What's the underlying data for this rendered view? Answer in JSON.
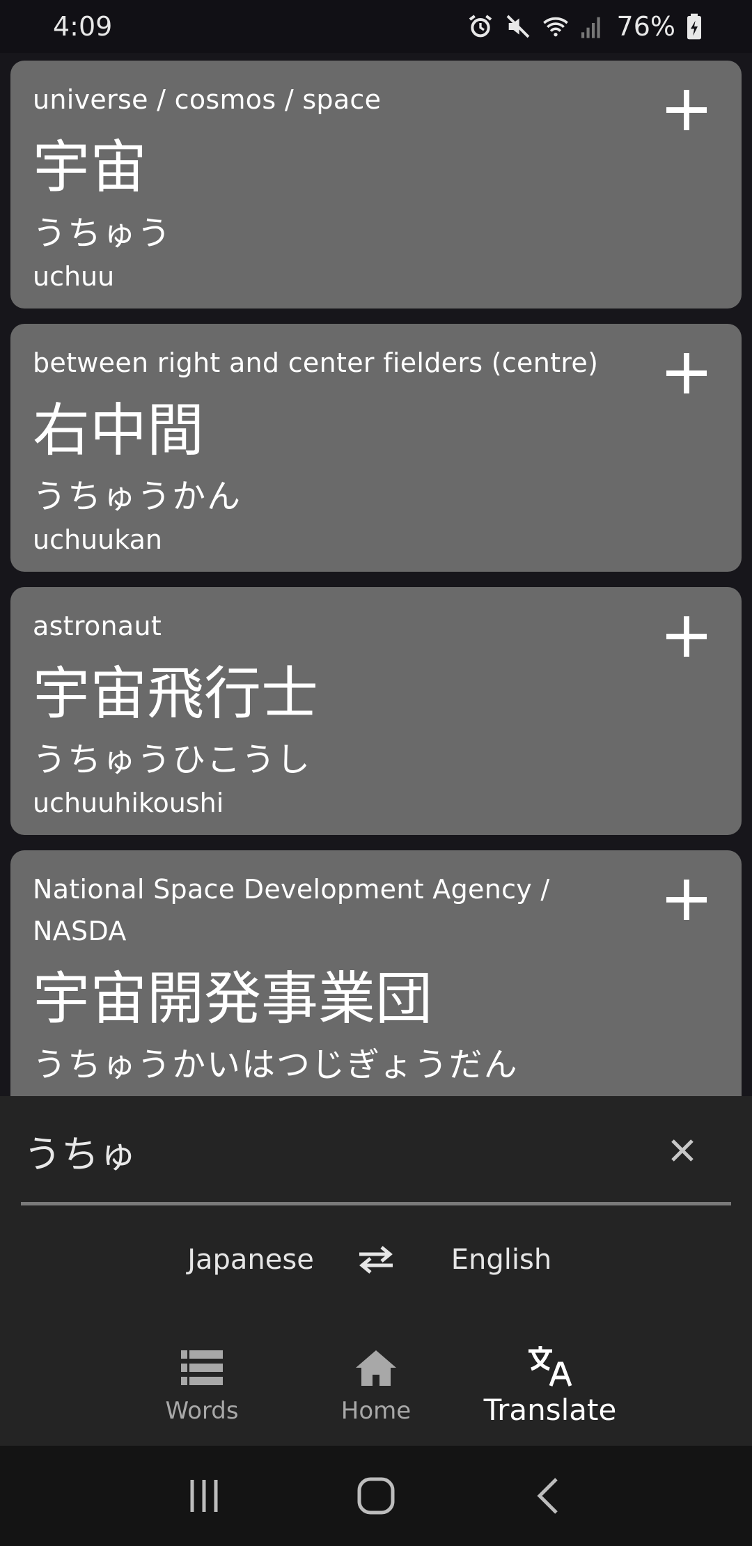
{
  "status_bar": {
    "time": "4:09",
    "battery": "76%",
    "icons": [
      "alarm-icon",
      "mute-icon",
      "wifi-icon",
      "signal-icon",
      "battery-charging-icon"
    ]
  },
  "results": [
    {
      "meaning": "universe / cosmos / space",
      "kanji": "宇宙",
      "kana": "うちゅう",
      "romaji": "uchuu"
    },
    {
      "meaning": "between right and center fielders (centre)",
      "kanji": "右中間",
      "kana": "うちゅうかん",
      "romaji": "uchuukan"
    },
    {
      "meaning": "astronaut",
      "kanji": "宇宙飛行士",
      "kana": "うちゅうひこうし",
      "romaji": "uchuuhikoushi"
    },
    {
      "meaning": "National Space Development Agency / NASDA",
      "kanji": "宇宙開発事業団",
      "kana": "うちゅうかいはつじぎょうだん",
      "romaji": ""
    }
  ],
  "search": {
    "value": "うちゅ",
    "clear_icon": "close-icon"
  },
  "languages": {
    "from": "Japanese",
    "to": "English",
    "swap_icon": "swap-icon"
  },
  "nav": {
    "words": "Words",
    "home": "Home",
    "translate": "Translate",
    "active": "translate"
  },
  "colors": {
    "background": "#17161b",
    "card": "#6a6a6a",
    "panel": "#242424",
    "inactive": "#a8a8a8"
  }
}
